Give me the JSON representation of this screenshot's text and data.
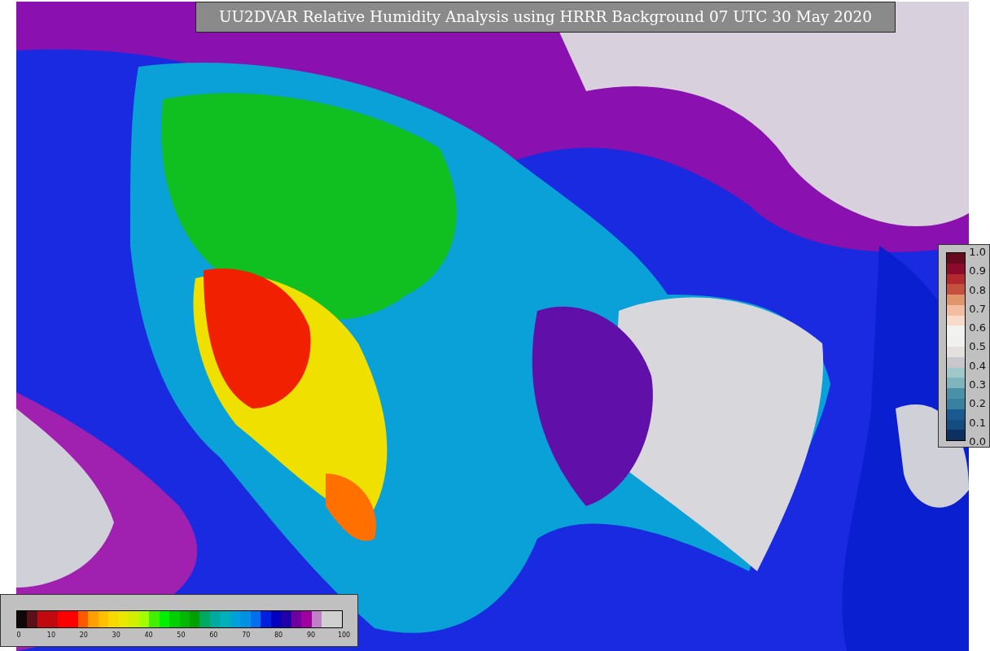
{
  "title": "UU2DVAR Relative Humidity Analysis using HRRR Background 07 UTC 30 May 2020",
  "humidity_scale": {
    "segments": [
      {
        "color": "#100808"
      },
      {
        "color": "#5a1018"
      },
      {
        "color": "#c00a10"
      },
      {
        "color": "#c00a10"
      },
      {
        "color": "#ff0000"
      },
      {
        "color": "#ff0000"
      },
      {
        "color": "#ff5a00"
      },
      {
        "color": "#ffa000"
      },
      {
        "color": "#ffc000"
      },
      {
        "color": "#f8d800"
      },
      {
        "color": "#e8e800"
      },
      {
        "color": "#d0f000"
      },
      {
        "color": "#a0ff00"
      },
      {
        "color": "#40f000"
      },
      {
        "color": "#00f000"
      },
      {
        "color": "#00d000"
      },
      {
        "color": "#00b800"
      },
      {
        "color": "#00a000"
      },
      {
        "color": "#00a860"
      },
      {
        "color": "#00aaa0"
      },
      {
        "color": "#00b0b8"
      },
      {
        "color": "#00a0d8"
      },
      {
        "color": "#0090e8"
      },
      {
        "color": "#0070f0"
      },
      {
        "color": "#0020e0"
      },
      {
        "color": "#0000c0"
      },
      {
        "color": "#2000a8"
      },
      {
        "color": "#7000a0"
      },
      {
        "color": "#a000a0"
      },
      {
        "color": "#c080c8"
      },
      {
        "color": "#d0d0d0"
      },
      {
        "color": "#d0d0d0"
      }
    ],
    "ticks": [
      "0",
      "10",
      "20",
      "30",
      "40",
      "50",
      "60",
      "70",
      "80",
      "90",
      "100"
    ]
  },
  "ratio_scale": {
    "segments": [
      {
        "color": "#670a1f"
      },
      {
        "color": "#8c0a2c"
      },
      {
        "color": "#b2282e"
      },
      {
        "color": "#c45040"
      },
      {
        "color": "#e0956a"
      },
      {
        "color": "#f2bda0"
      },
      {
        "color": "#f8dacb"
      },
      {
        "color": "#f2f2f0"
      },
      {
        "color": "#f0f0ee"
      },
      {
        "color": "#e4e0de"
      },
      {
        "color": "#c8c8cc"
      },
      {
        "color": "#a0c8c8"
      },
      {
        "color": "#80b4bc"
      },
      {
        "color": "#4a90a8"
      },
      {
        "color": "#3a80a0"
      },
      {
        "color": "#1a5a90"
      },
      {
        "color": "#154d80"
      },
      {
        "color": "#0c3060"
      }
    ],
    "ticks": [
      "1.0",
      "0.9",
      "0.8",
      "0.7",
      "0.6",
      "0.5",
      "0.4",
      "0.3",
      "0.2",
      "0.1",
      "0.0"
    ]
  }
}
